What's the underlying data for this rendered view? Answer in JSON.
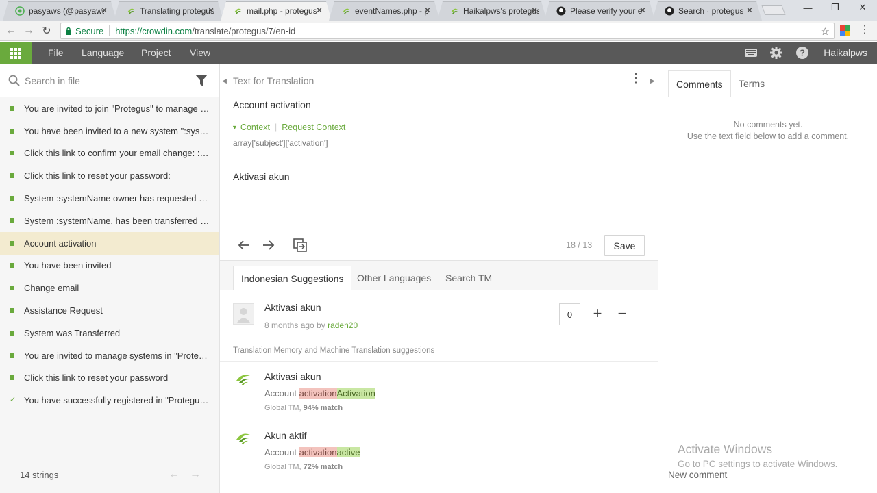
{
  "browser": {
    "tabs": [
      {
        "title": "pasyaws (@pasyaws)",
        "icon": "twitter-icon"
      },
      {
        "title": "Translating protegus",
        "icon": "crowdin-icon"
      },
      {
        "title": "mail.php - protegus",
        "icon": "crowdin-icon",
        "active": true
      },
      {
        "title": "eventNames.php - p",
        "icon": "crowdin-icon"
      },
      {
        "title": "Haikalpws's protegus",
        "icon": "crowdin-icon"
      },
      {
        "title": "Please verify your e",
        "icon": "github-icon"
      },
      {
        "title": "Search · protegus",
        "icon": "github-icon"
      }
    ],
    "secure_label": "Secure",
    "url_main": "https://crowdin.com",
    "url_rest": "/translate/protegus/7/en-id"
  },
  "appbar": {
    "menu": [
      "File",
      "Language",
      "Project",
      "View"
    ],
    "user": "Haikalpws",
    "brand_color": "#6aaa3d"
  },
  "left": {
    "search_placeholder": "Search in file",
    "strings": [
      {
        "text": "You are invited to join \"Protegus\" to manage t…",
        "state": "translated"
      },
      {
        "text": "You have been invited to a new system \":syste…",
        "state": "translated"
      },
      {
        "text": "Click this link to confirm your email change: :link",
        "state": "translated"
      },
      {
        "text": "Click this link to reset your password:",
        "state": "translated"
      },
      {
        "text": "System :systemName owner has requested as…",
        "state": "translated"
      },
      {
        "text": "System :systemName, has been transferred to…",
        "state": "translated"
      },
      {
        "text": "Account activation",
        "state": "translated",
        "active": true
      },
      {
        "text": "You have been invited",
        "state": "translated"
      },
      {
        "text": "Change email",
        "state": "translated"
      },
      {
        "text": "Assistance Request",
        "state": "translated"
      },
      {
        "text": "System was Transferred",
        "state": "translated"
      },
      {
        "text": "You are invited to manage systems in \"Proteg…",
        "state": "translated"
      },
      {
        "text": "Click this link to reset your password",
        "state": "translated"
      },
      {
        "text": "You have successfully registered in \"Protegus\"…",
        "state": "approved"
      }
    ],
    "count_label": "14 strings"
  },
  "editor": {
    "section_label": "Text for Translation",
    "source_text": "Account activation",
    "context_label": "Context",
    "request_context_label": "Request Context",
    "context_key": "array['subject']['activation']",
    "translation": "Aktivasi akun",
    "progress": "18 / 13",
    "save_label": "Save",
    "suggestion_tabs": [
      "Indonesian Suggestions",
      "Other Languages",
      "Search TM"
    ],
    "vote": {
      "text": "Aktivasi akun",
      "time": "8 months ago by",
      "author": "raden20",
      "count": "0"
    },
    "tm_header": "Translation Memory and Machine Translation suggestions",
    "tm": [
      {
        "text": "Aktivasi akun",
        "diff_plain": "Account ",
        "diff_del": "activation",
        "diff_ins": "Activation",
        "match_source": "Global TM, ",
        "match_pct": "94% match"
      },
      {
        "text": "Akun aktif",
        "diff_plain": "Account ",
        "diff_del": "activation",
        "diff_ins": "active",
        "match_source": "Global TM, ",
        "match_pct": "72% match"
      }
    ]
  },
  "right": {
    "tabs": [
      "Comments",
      "Terms"
    ],
    "empty_line1": "No comments yet.",
    "empty_line2": "Use the text field below to add a comment.",
    "watermark_title": "Activate Windows",
    "watermark_sub": "Go to PC settings to activate Windows.",
    "new_comment_placeholder": "New comment"
  }
}
